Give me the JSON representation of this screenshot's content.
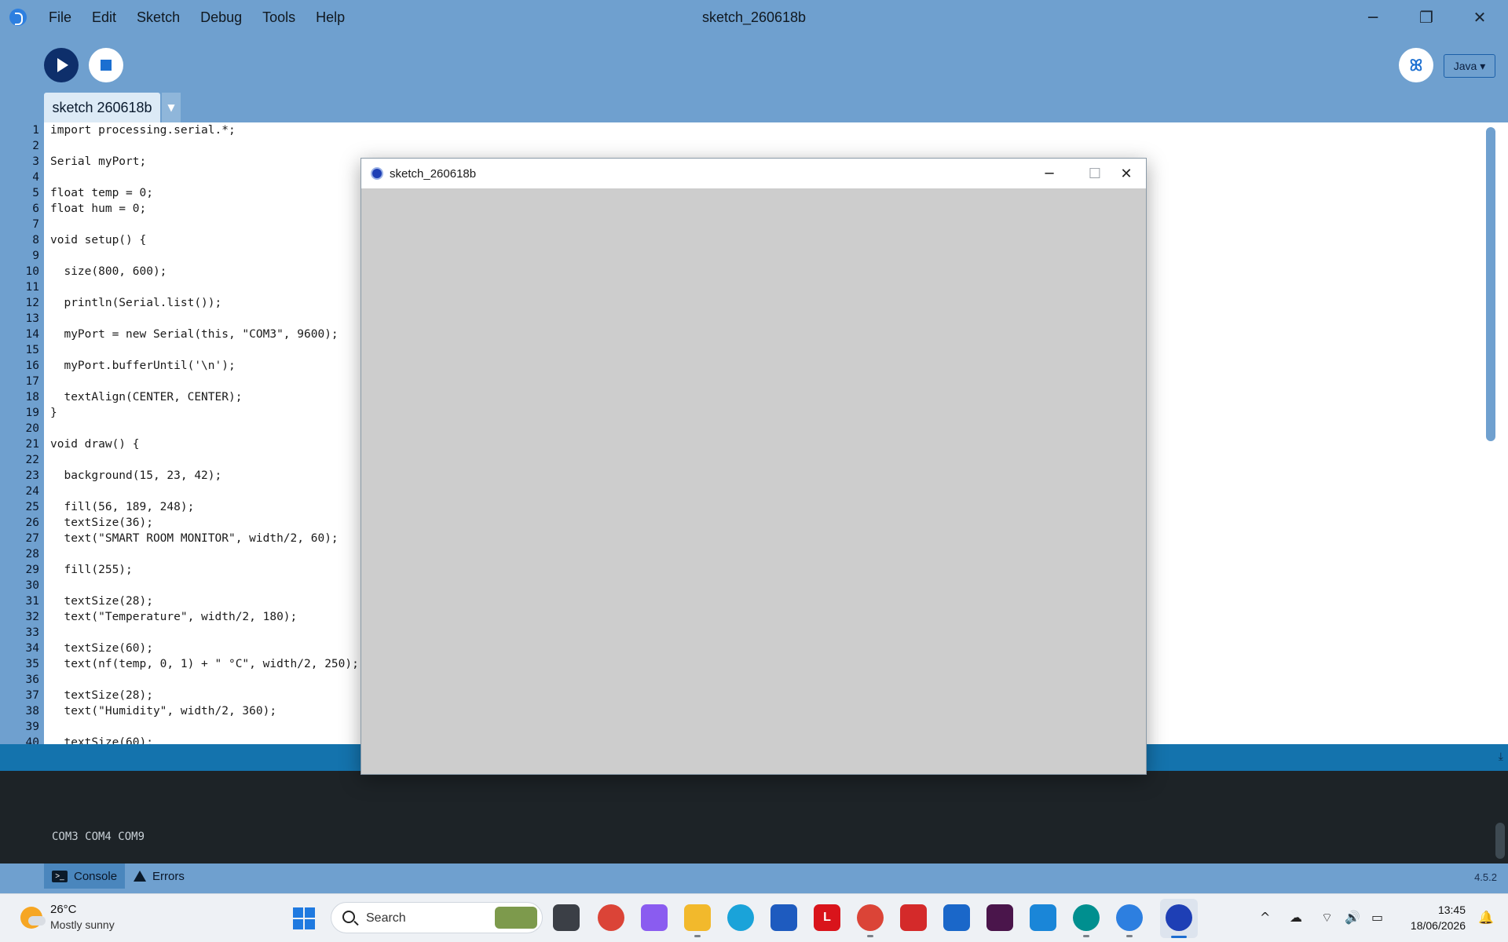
{
  "window": {
    "title": "sketch_260618b",
    "menu": [
      "File",
      "Edit",
      "Sketch",
      "Debug",
      "Tools",
      "Help"
    ],
    "minimize": "─",
    "maximize": "❐",
    "close": "✕"
  },
  "toolbar": {
    "mode": "Java ▾",
    "debug_glyph": "ꕤ"
  },
  "tabs": {
    "active": "sketch 260618b",
    "menu_glyph": "▼"
  },
  "editor": {
    "lines": [
      {
        "n": "1",
        "t": "import processing.serial.*;"
      },
      {
        "n": "2",
        "t": ""
      },
      {
        "n": "3",
        "t": "Serial myPort;"
      },
      {
        "n": "4",
        "t": ""
      },
      {
        "n": "5",
        "t": "float temp = 0;"
      },
      {
        "n": "6",
        "t": "float hum = 0;"
      },
      {
        "n": "7",
        "t": ""
      },
      {
        "n": "8",
        "t": "void setup() {"
      },
      {
        "n": "9",
        "t": ""
      },
      {
        "n": "10",
        "t": "  size(800, 600);"
      },
      {
        "n": "11",
        "t": ""
      },
      {
        "n": "12",
        "t": "  println(Serial.list());"
      },
      {
        "n": "13",
        "t": ""
      },
      {
        "n": "14",
        "t": "  myPort = new Serial(this, \"COM3\", 9600);"
      },
      {
        "n": "15",
        "t": ""
      },
      {
        "n": "16",
        "t": "  myPort.bufferUntil('\\n');"
      },
      {
        "n": "17",
        "t": ""
      },
      {
        "n": "18",
        "t": "  textAlign(CENTER, CENTER);"
      },
      {
        "n": "19",
        "t": "}"
      },
      {
        "n": "20",
        "t": ""
      },
      {
        "n": "21",
        "t": "void draw() {"
      },
      {
        "n": "22",
        "t": ""
      },
      {
        "n": "23",
        "t": "  background(15, 23, 42);"
      },
      {
        "n": "24",
        "t": ""
      },
      {
        "n": "25",
        "t": "  fill(56, 189, 248);"
      },
      {
        "n": "26",
        "t": "  textSize(36);"
      },
      {
        "n": "27",
        "t": "  text(\"SMART ROOM MONITOR\", width/2, 60);"
      },
      {
        "n": "28",
        "t": ""
      },
      {
        "n": "29",
        "t": "  fill(255);"
      },
      {
        "n": "30",
        "t": ""
      },
      {
        "n": "31",
        "t": "  textSize(28);"
      },
      {
        "n": "32",
        "t": "  text(\"Temperature\", width/2, 180);"
      },
      {
        "n": "33",
        "t": ""
      },
      {
        "n": "34",
        "t": "  textSize(60);"
      },
      {
        "n": "35",
        "t": "  text(nf(temp, 0, 1) + \" °C\", width/2, 250);"
      },
      {
        "n": "36",
        "t": ""
      },
      {
        "n": "37",
        "t": "  textSize(28);"
      },
      {
        "n": "38",
        "t": "  text(\"Humidity\", width/2, 360);"
      },
      {
        "n": "39",
        "t": ""
      },
      {
        "n": "40",
        "t": "  textSize(60);"
      }
    ]
  },
  "sketch_window": {
    "title": "sketch_260618b",
    "minimize": "─",
    "maximize": "☐",
    "close": "✕"
  },
  "console": {
    "output": "COM3 COM4 COM9",
    "collapse_glyph": "⤓"
  },
  "footer": {
    "console_tab": "Console",
    "errors_tab": "Errors",
    "version": "4.5.2"
  },
  "taskbar": {
    "weather_temp": "26°C",
    "weather_desc": "Mostly sunny",
    "search_placeholder": "Search",
    "time": "13:45",
    "date": "18/06/2026",
    "tray_up": "^",
    "tray_cloud": "☁",
    "tray_wifi": "⌔",
    "tray_volume": "🔊",
    "tray_battery": "▭",
    "notifications": "🔔"
  },
  "colors": {
    "accent": "#6fa0cf",
    "console_bg": "#1d2327",
    "sketch_canvas": "#cdcdcd"
  }
}
